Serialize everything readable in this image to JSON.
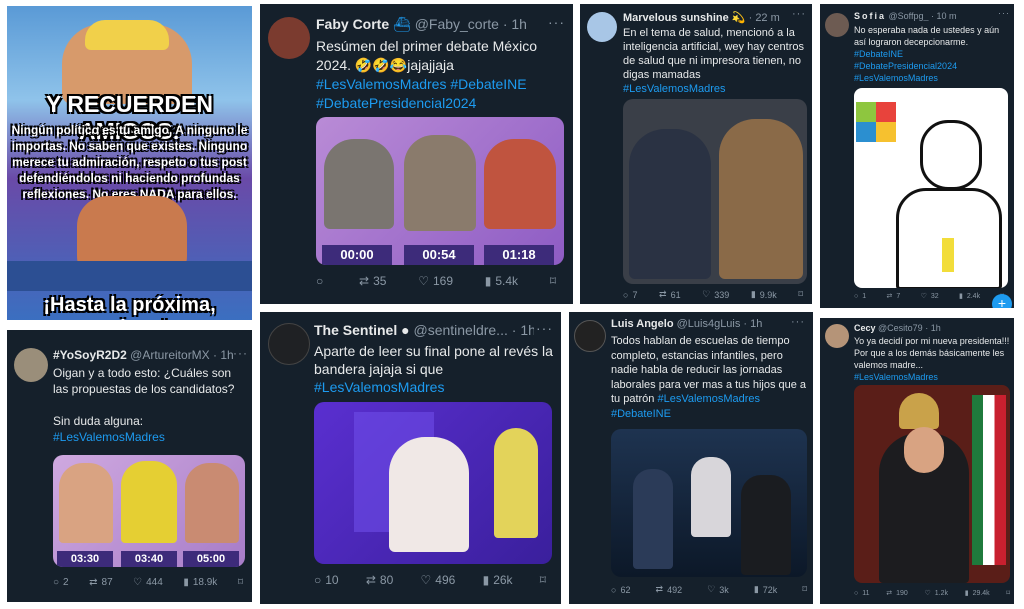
{
  "meme": {
    "title": "Y RECUERDEN AMIGOS:",
    "body": "Ningún político es tu amigo. A ninguno le importas. No saben que existes. Ninguno merece tu admiración, respeto o tus post defendiéndolos ni haciendo profundas reflexiones. No eres NADA para ellos.",
    "footer": "¡Hasta la próxima, amigos!"
  },
  "tweets": [
    {
      "name": "Faby Corte",
      "handle": "@Faby_corte",
      "time": "1h",
      "text": "Resúmen del primer debate México 2024. 🤣🤣😂jajajjaja",
      "tags": "#LesValemosMadres #DebateINE #DebatePresidencial2024",
      "reply": "",
      "retweet": "35",
      "like": "169",
      "views": "5.4k",
      "timers": [
        "00:00",
        "00:54",
        "01:18"
      ]
    },
    {
      "name": "Marvelous sunshine",
      "handle": "",
      "time": "22 m",
      "text": "En el tema de salud, mencionó a la inteligencia artificial, wey hay centros de salud que ni impresora tienen,  no digas mamadas",
      "tags": "#LesValemosMadres",
      "reply": "7",
      "retweet": "61",
      "like": "339",
      "views": "9.9k"
    },
    {
      "name": "Sofia",
      "handle": "@Soffpg_",
      "time": "10 m",
      "text": "No esperaba nada de ustedes y aún así lograron decepcionarme.",
      "tags": "#DebateINE #DebatePresidencial2024 #LesValemosMadres",
      "reply": "1",
      "retweet": "7",
      "like": "32",
      "views": "2.4k"
    },
    {
      "name": "#YoSoyR2D2",
      "handle": "@ArtureitorMX",
      "time": "1h",
      "text": "Oigan y a todo esto: ¿Cuáles son las propuestas de los candidatos?",
      "text2": "Sin duda alguna:",
      "tags": "#LesValemosMadres",
      "reply": "2",
      "retweet": "87",
      "like": "444",
      "views": "18.9k",
      "timers": [
        "03:30",
        "03:40",
        "05:00"
      ]
    },
    {
      "name": "The Sentinel",
      "handle": "@sentineldre...",
      "time": "1h",
      "text": "Aparte de leer su final pone al revés la bandera jajaja si que",
      "tags": "#LesValemosMadres",
      "reply": "10",
      "retweet": "80",
      "like": "496",
      "views": "26k"
    },
    {
      "name": "Luis Angelo",
      "handle": "@Luis4gLuis",
      "time": "1h",
      "text": "Todos hablan de escuelas de tiempo completo, estancias infantiles, pero nadie habla de reducir las jornadas laborales para ver mas a tus hijos que a tu patrón",
      "tags": "#LesValemosMadres #DebateINE",
      "reply": "62",
      "retweet": "492",
      "like": "3k",
      "views": "72k"
    },
    {
      "name": "Cecy",
      "handle": "@Cesito79",
      "time": "1h",
      "text": "Yo ya decidí por mi nueva presidenta!!! Por que a los demás básicamente les valemos madre...",
      "tags": "#LesValemosMadres",
      "reply": "11",
      "retweet": "190",
      "like": "1.2k",
      "views": "29.4k"
    }
  ]
}
